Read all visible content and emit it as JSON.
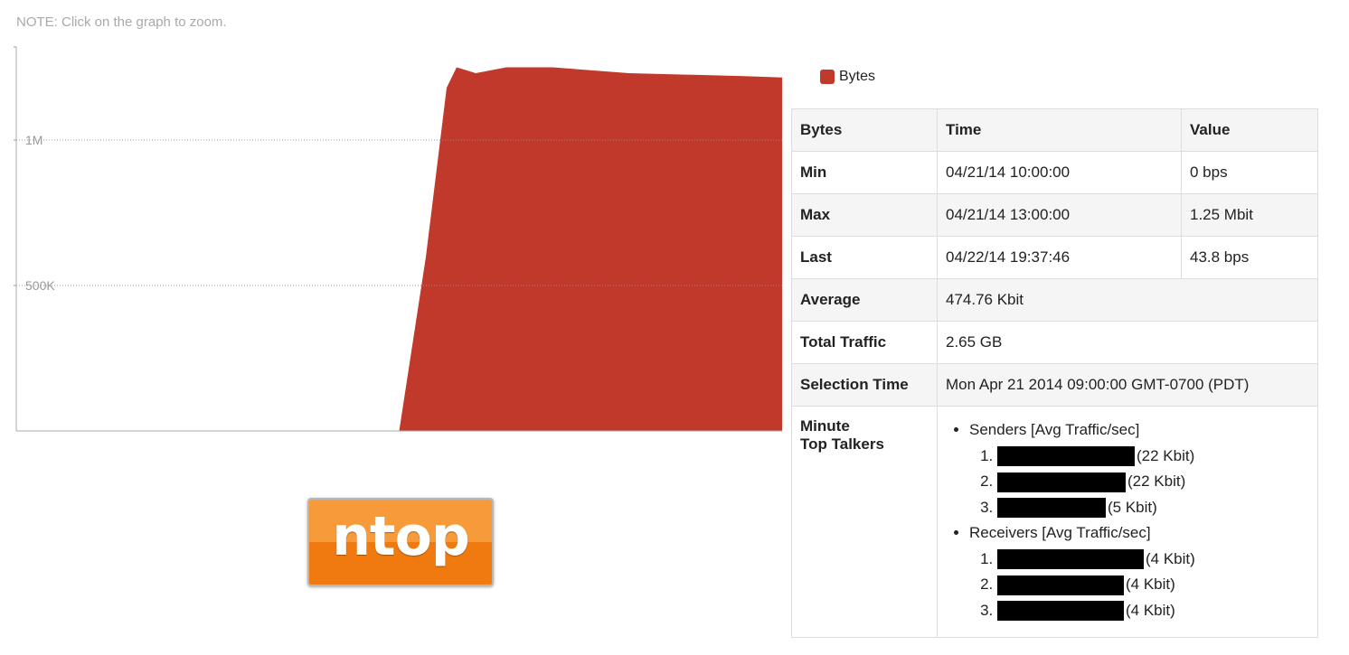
{
  "note": "NOTE: Click on the graph to zoom.",
  "chart_data": {
    "type": "area",
    "series": [
      {
        "name": "Bytes",
        "color": "#c0392b",
        "points": [
          [
            0,
            0
          ],
          [
            0.46,
            0
          ],
          [
            0.5,
            0
          ],
          [
            0.535,
            600000
          ],
          [
            0.562,
            1180000
          ],
          [
            0.575,
            1250000
          ],
          [
            0.6,
            1230000
          ],
          [
            0.64,
            1250000
          ],
          [
            0.7,
            1250000
          ],
          [
            0.8,
            1230000
          ],
          [
            0.95,
            1220000
          ],
          [
            1.0,
            1215000
          ]
        ]
      }
    ],
    "y_ticks": [
      {
        "value": 1000000,
        "label": "1M"
      },
      {
        "value": 500000,
        "label": "500K"
      }
    ],
    "ylim": [
      0,
      1320000
    ],
    "grid": true
  },
  "legend": {
    "label": "Bytes",
    "color": "#c0392b"
  },
  "table": {
    "headers": [
      "Bytes",
      "Time",
      "Value"
    ],
    "rows": [
      {
        "label": "Min",
        "time": "04/21/14 10:00:00",
        "value": "0 bps"
      },
      {
        "label": "Max",
        "time": "04/21/14 13:00:00",
        "value": "1.25 Mbit"
      },
      {
        "label": "Last",
        "time": "04/22/14 19:37:46",
        "value": "43.8 bps"
      }
    ],
    "average": {
      "label": "Average",
      "value": "474.76 Kbit"
    },
    "total": {
      "label": "Total Traffic",
      "value": "2.65 GB"
    },
    "selection": {
      "label": "Selection Time",
      "value": "Mon Apr 21 2014 09:00:00 GMT-0700 (PDT)"
    },
    "talkers": {
      "label_line1": "Minute",
      "label_line2": "Top Talkers",
      "senders_title": "Senders [Avg Traffic/sec]",
      "senders": [
        {
          "value": "(22 Kbit)"
        },
        {
          "value": "(22 Kbit)"
        },
        {
          "value": "(5 Kbit)"
        }
      ],
      "receivers_title": "Receivers [Avg Traffic/sec]",
      "receivers": [
        {
          "value": "(4 Kbit)"
        },
        {
          "value": "(4 Kbit)"
        },
        {
          "value": "(4 Kbit)"
        }
      ]
    }
  },
  "logo": {
    "text": "ntop"
  }
}
